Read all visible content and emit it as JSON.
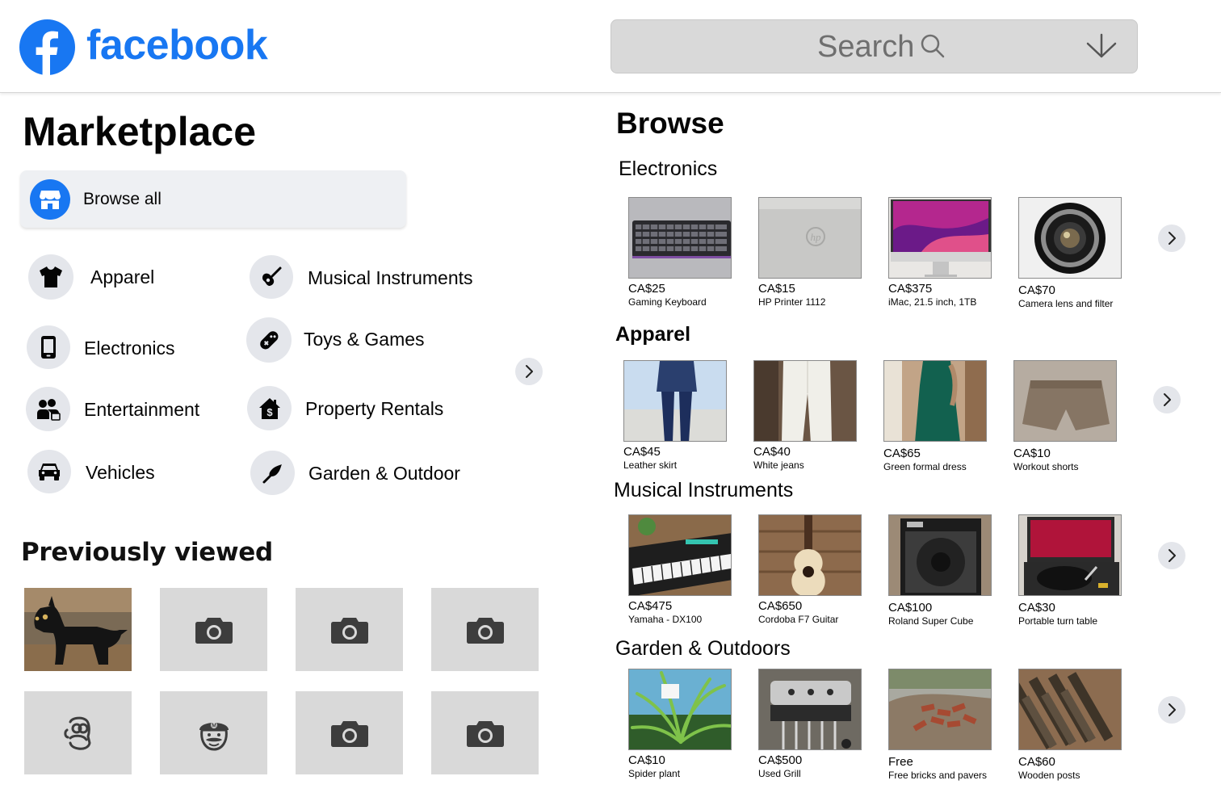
{
  "header": {
    "brand": "facebook",
    "search_text": "Search"
  },
  "sidebar": {
    "title": "Marketplace",
    "browse_all": "Browse all",
    "categories": [
      {
        "label": "Apparel",
        "icon": "shirt-icon"
      },
      {
        "label": "Musical Instruments",
        "icon": "guitar-icon"
      },
      {
        "label": "Electronics",
        "icon": "phone-icon"
      },
      {
        "label": "Toys & Games",
        "icon": "gamepad-icon"
      },
      {
        "label": "Entertainment",
        "icon": "people-icon"
      },
      {
        "label": "Property Rentals",
        "icon": "house-dollar-icon"
      },
      {
        "label": "Vehicles",
        "icon": "car-icon"
      },
      {
        "label": "Garden & Outdoor",
        "icon": "shovel-icon"
      }
    ],
    "previously_viewed_title": "Previously viewed",
    "previously_viewed": [
      {
        "icon": "dog-figurine-photo"
      },
      {
        "icon": "camera-icon"
      },
      {
        "icon": "camera-icon"
      },
      {
        "icon": "camera-icon"
      },
      {
        "icon": "homer-icon"
      },
      {
        "icon": "mario-icon"
      },
      {
        "icon": "camera-icon"
      },
      {
        "icon": "camera-icon"
      }
    ]
  },
  "browse": {
    "title": "Browse",
    "sections": [
      {
        "title": "Electronics",
        "items": [
          {
            "price": "CA$25",
            "title": "Gaming Keyboard"
          },
          {
            "price": "CA$15",
            "title": "HP Printer 1112"
          },
          {
            "price": "CA$375",
            "title": "iMac, 21.5 inch, 1TB"
          },
          {
            "price": "CA$70",
            "title": "Camera lens and filter"
          }
        ]
      },
      {
        "title": "Apparel",
        "items": [
          {
            "price": "CA$45",
            "title": "Leather skirt"
          },
          {
            "price": "CA$40",
            "title": "White jeans"
          },
          {
            "price": "CA$65",
            "title": "Green formal dress"
          },
          {
            "price": "CA$10",
            "title": "Workout shorts"
          }
        ]
      },
      {
        "title": "Musical Instruments",
        "items": [
          {
            "price": "CA$475",
            "title": "Yamaha - DX100"
          },
          {
            "price": "CA$650",
            "title": "Cordoba F7 Guitar"
          },
          {
            "price": "CA$100",
            "title": "Roland Super Cube"
          },
          {
            "price": "CA$30",
            "title": "Portable turn table"
          }
        ]
      },
      {
        "title": "Garden & Outdoors",
        "items": [
          {
            "price": "CA$10",
            "title": "Spider plant"
          },
          {
            "price": "CA$500",
            "title": "Used Grill"
          },
          {
            "price": "Free",
            "title": "Free bricks and pavers"
          },
          {
            "price": "CA$60",
            "title": "Wooden posts"
          }
        ]
      }
    ]
  },
  "colors": {
    "brand": "#1877f2",
    "search_bg": "#d9d9d9",
    "icon_circle": "#e4e6eb",
    "thumb_placeholder": "#d9d9d9"
  }
}
